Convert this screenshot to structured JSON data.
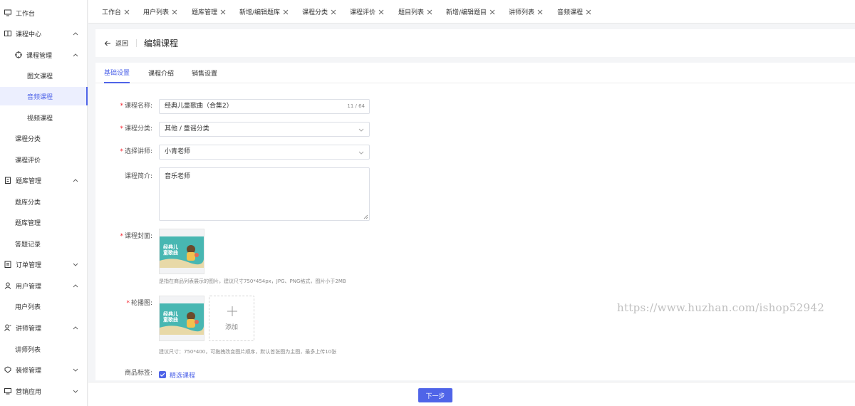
{
  "sidebar": {
    "items": [
      {
        "label": "工作台",
        "icon": "monitor-icon"
      },
      {
        "label": "课程中心",
        "icon": "book-icon"
      },
      {
        "label": "课程管理",
        "icon": "target-icon"
      },
      {
        "label": "图文课程"
      },
      {
        "label": "音频课程"
      },
      {
        "label": "视频课程"
      },
      {
        "label": "课程分类"
      },
      {
        "label": "课程评价"
      },
      {
        "label": "题库管理",
        "icon": "clipboard-icon"
      },
      {
        "label": "题库分类"
      },
      {
        "label": "题库管理"
      },
      {
        "label": "答题记录"
      },
      {
        "label": "订单管理",
        "icon": "order-icon"
      },
      {
        "label": "用户管理",
        "icon": "user-icon"
      },
      {
        "label": "用户列表"
      },
      {
        "label": "讲师管理",
        "icon": "teacher-icon"
      },
      {
        "label": "讲师列表"
      },
      {
        "label": "装修管理",
        "icon": "decorate-icon"
      },
      {
        "label": "营销应用",
        "icon": "marketing-icon"
      }
    ]
  },
  "tabs": [
    "工作台",
    "用户列表",
    "题库管理",
    "新增/编辑题库",
    "课程分类",
    "课程评价",
    "题目列表",
    "新增/编辑题目",
    "讲师列表",
    "音频课程"
  ],
  "header": {
    "back_label": "返回",
    "title": "编辑课程"
  },
  "sub_tabs": [
    "基础设置",
    "课程介绍",
    "销售设置"
  ],
  "form": {
    "name_label": "课程名称:",
    "name_value": "经典儿童歌曲（合集2）",
    "name_count": "11 / 64",
    "category_label": "课程分类:",
    "category_value": "其他 / 童谣分类",
    "teacher_label": "选择讲师:",
    "teacher_value": "小青老师",
    "intro_label": "课程简介:",
    "intro_value": "音乐老师",
    "cover_label": "课程封面:",
    "cover_image_text": "经典儿童歌曲",
    "cover_hint": "是指在商品列表展示的图片，建议尺寸750*454px，JPG、PNG格式，图片小于2MB",
    "carousel_label": "轮播图:",
    "add_label": "添加",
    "carousel_hint": "建议尺寸：750*400，可拖拽改变图片顺序，默认首张图为主图，最多上传10张",
    "tags_label": "商品标签:",
    "tag_option": "精选课程"
  },
  "watermark": "https://www.huzhan.com/ishop52942",
  "footer": {
    "next_label": "下一步"
  },
  "colors": {
    "accent": "#4f64e8",
    "required": "#f5222d"
  }
}
